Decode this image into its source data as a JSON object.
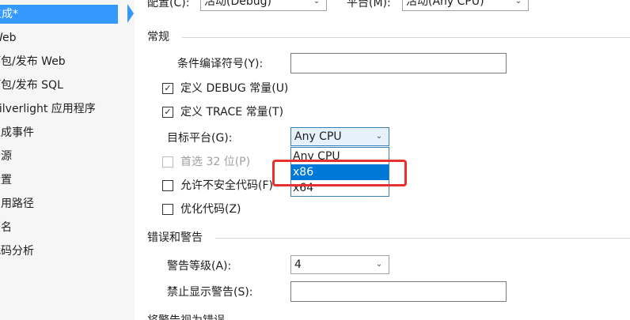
{
  "sidebar": {
    "items": [
      {
        "label": "生成*",
        "active": true
      },
      {
        "label": "Web"
      },
      {
        "label": "打包/发布 Web"
      },
      {
        "label": "打包/发布 SQL"
      },
      {
        "label": "Silverlight 应用程序"
      },
      {
        "label": "生成事件"
      },
      {
        "label": "资源"
      },
      {
        "label": "设置"
      },
      {
        "label": "引用路径"
      },
      {
        "label": "签名"
      },
      {
        "label": "代码分析"
      }
    ]
  },
  "top": {
    "config_label": "配置(C):",
    "config_value": "活动(Debug)",
    "platform_label": "平台(M):",
    "platform_value": "活动(Any CPU)"
  },
  "general": {
    "title": "常规",
    "symbols_label": "条件编译符号(Y):",
    "symbols_value": "",
    "debug_label": "定义 DEBUG 常量(U)",
    "debug_checked": true,
    "trace_label": "定义 TRACE 常量(T)",
    "trace_checked": true,
    "target_label": "目标平台(G):",
    "target_value": "Any CPU",
    "prefer32_label": "首选 32 位(P)",
    "prefer32_checked": false,
    "unsafe_label": "允许不安全代码(F)",
    "unsafe_checked": false,
    "optimize_label": "优化代码(Z)",
    "optimize_checked": false
  },
  "dropdown": {
    "options": [
      "Any CPU",
      "x86",
      "x64"
    ],
    "highlighted": "x86"
  },
  "errors": {
    "title": "错误和警告",
    "warning_level_label": "警告等级(A):",
    "warning_level_value": "4",
    "suppress_label": "禁止显示警告(S):",
    "suppress_value": "",
    "next_section_title": "将警告视为错误"
  },
  "colors": {
    "selection": "#3399ff",
    "dropdown_highlight": "#0078d7",
    "annotation_red": "#e8312f"
  },
  "icons": [
    "check-icon",
    "chevron-down-icon"
  ]
}
